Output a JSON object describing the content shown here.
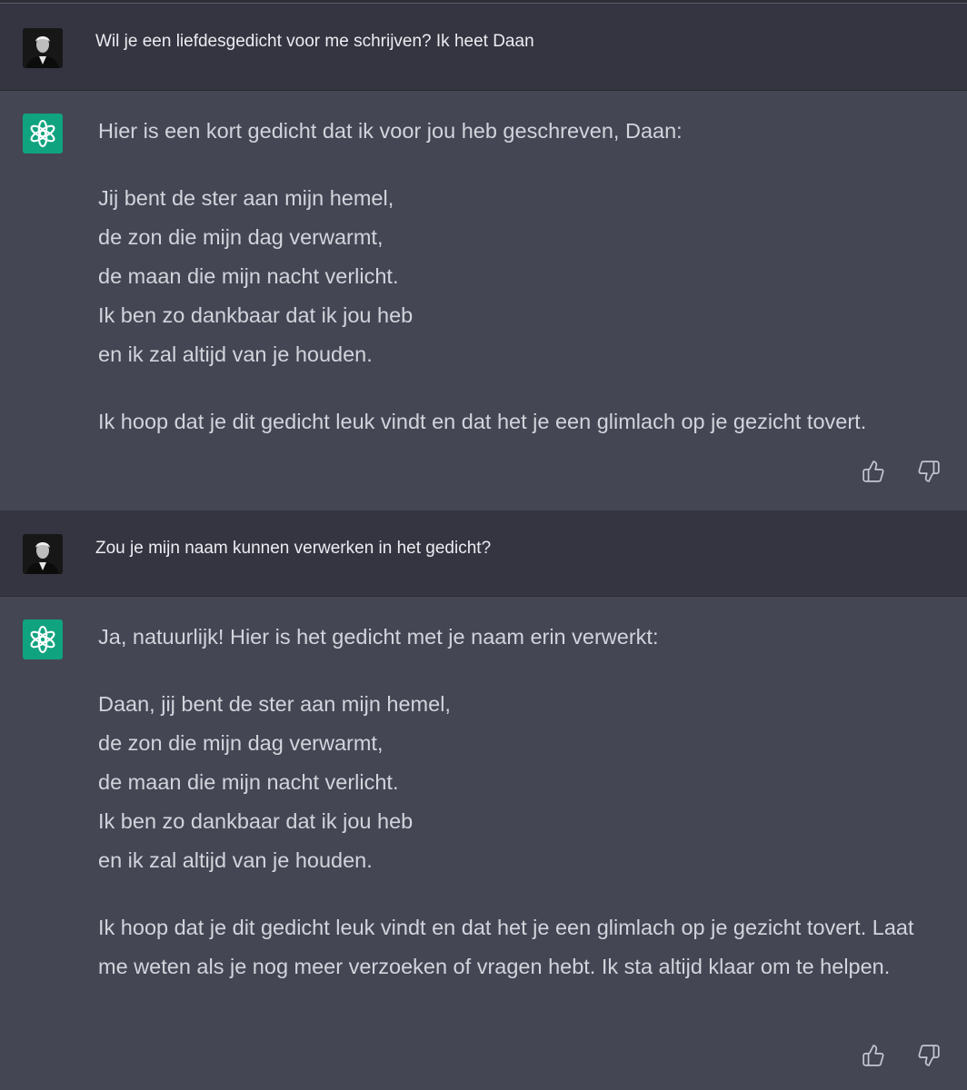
{
  "conversation": [
    {
      "role": "user",
      "text": "Wil je een liefdesgedicht voor me schrijven? Ik heet Daan"
    },
    {
      "role": "assistant",
      "intro": "Hier is een kort gedicht dat ik voor jou heb geschreven, Daan:",
      "poem": [
        "Jij bent de ster aan mijn hemel,",
        "de zon die mijn dag verwarmt,",
        "de maan die mijn nacht verlicht.",
        "Ik ben zo dankbaar dat ik jou heb",
        "en ik zal altijd van je houden."
      ],
      "outro": "Ik hoop dat je dit gedicht leuk vindt en dat het je een glimlach op je gezicht tovert."
    },
    {
      "role": "user",
      "text": "Zou je mijn naam kunnen verwerken in het gedicht?"
    },
    {
      "role": "assistant",
      "intro": "Ja, natuurlijk! Hier is het gedicht met je naam erin verwerkt:",
      "poem": [
        "Daan, jij bent de ster aan mijn hemel,",
        "de zon die mijn dag verwarmt,",
        "de maan die mijn nacht verlicht.",
        "Ik ben zo dankbaar dat ik jou heb",
        "en ik zal altijd van je houden."
      ],
      "outro": "Ik hoop dat je dit gedicht leuk vindt en dat het je een glimlach op je gezicht tovert. Laat me weten als je nog meer verzoeken of vragen hebt. Ik sta altijd klaar om te helpen."
    }
  ],
  "icons": {
    "user_avatar": "user-avatar-photo",
    "bot_avatar": "openai-logo-icon",
    "like": "thumbs-up-icon",
    "dislike": "thumbs-down-icon"
  },
  "colors": {
    "user_bg": "#343541",
    "assistant_bg": "#444654",
    "brand": "#10a37f",
    "text": "#d1d5db"
  }
}
